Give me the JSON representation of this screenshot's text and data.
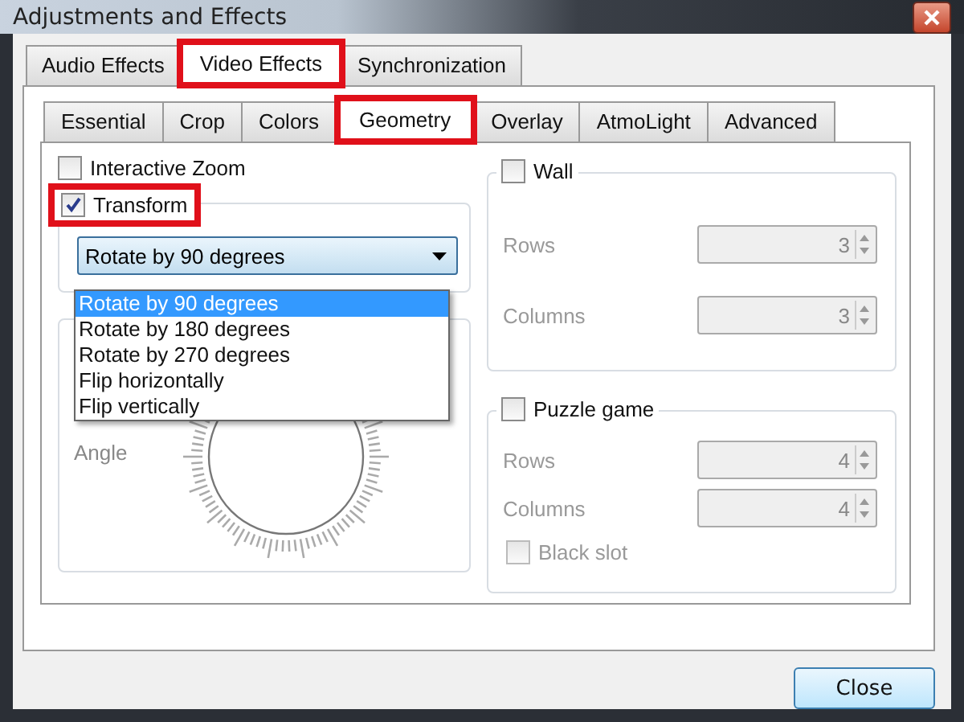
{
  "window": {
    "title": "Adjustments and Effects"
  },
  "tabs": [
    {
      "label": "Audio Effects",
      "selected": false,
      "highlighted": false
    },
    {
      "label": "Video Effects",
      "selected": true,
      "highlighted": true
    },
    {
      "label": "Synchronization",
      "selected": false,
      "highlighted": false
    }
  ],
  "subtabs": [
    {
      "label": "Essential",
      "selected": false,
      "highlighted": false
    },
    {
      "label": "Crop",
      "selected": false,
      "highlighted": false
    },
    {
      "label": "Colors",
      "selected": false,
      "highlighted": false
    },
    {
      "label": "Geometry",
      "selected": true,
      "highlighted": true
    },
    {
      "label": "Overlay",
      "selected": false,
      "highlighted": false
    },
    {
      "label": "AtmoLight",
      "selected": false,
      "highlighted": false
    },
    {
      "label": "Advanced",
      "selected": false,
      "highlighted": false
    }
  ],
  "interactive_zoom": {
    "label": "Interactive Zoom",
    "checked": false
  },
  "transform": {
    "label": "Transform",
    "checked": true,
    "highlighted": true,
    "value": "Rotate by 90 degrees",
    "options": [
      {
        "label": "Rotate by 90 degrees",
        "selected": true
      },
      {
        "label": "Rotate by 180 degrees",
        "selected": false
      },
      {
        "label": "Rotate by 270 degrees",
        "selected": false
      },
      {
        "label": "Flip horizontally",
        "selected": false
      },
      {
        "label": "Flip vertically",
        "selected": false
      }
    ]
  },
  "angle": {
    "label": "Angle"
  },
  "wall": {
    "label": "Wall",
    "checked": false,
    "fields": [
      {
        "label": "Rows",
        "value": "3",
        "disabled": true
      },
      {
        "label": "Columns",
        "value": "3",
        "disabled": true
      }
    ]
  },
  "puzzle": {
    "label": "Puzzle game",
    "checked": false,
    "fields": [
      {
        "label": "Rows",
        "value": "4",
        "disabled": true
      },
      {
        "label": "Columns",
        "value": "4",
        "disabled": true
      }
    ],
    "black_slot": {
      "label": "Black slot",
      "checked": false,
      "disabled": true
    }
  },
  "buttons": [
    {
      "label": "Close"
    }
  ]
}
